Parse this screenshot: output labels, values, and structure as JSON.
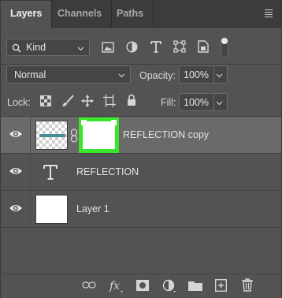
{
  "tabs": [
    {
      "label": "Layers",
      "active": true
    },
    {
      "label": "Channels",
      "active": false
    },
    {
      "label": "Paths",
      "active": false
    }
  ],
  "filter": {
    "label": "Kind"
  },
  "blend_mode": {
    "value": "Normal"
  },
  "opacity": {
    "label": "Opacity:",
    "value": "100%"
  },
  "lock": {
    "label": "Lock:"
  },
  "fill": {
    "label": "Fill:",
    "value": "100%"
  },
  "layers": [
    {
      "name": "REFLECTION copy",
      "type": "masked-image",
      "selected": true,
      "visible": true
    },
    {
      "name": "REFLECTION",
      "type": "text",
      "selected": false,
      "visible": true
    },
    {
      "name": "Layer 1",
      "type": "pixel",
      "selected": false,
      "visible": true
    }
  ],
  "footer_icons": [
    "link-layers-icon",
    "fx-icon",
    "add-mask-icon",
    "adjustment-layer-icon",
    "new-group-icon",
    "new-layer-icon",
    "trash-icon"
  ],
  "colors": {
    "panel_bg": "#535353",
    "tab_bar": "#3c3c3c",
    "selected_row": "#6a6a6a",
    "mask_highlight": "#39e62a",
    "thumb_text": "#2a7c86"
  }
}
